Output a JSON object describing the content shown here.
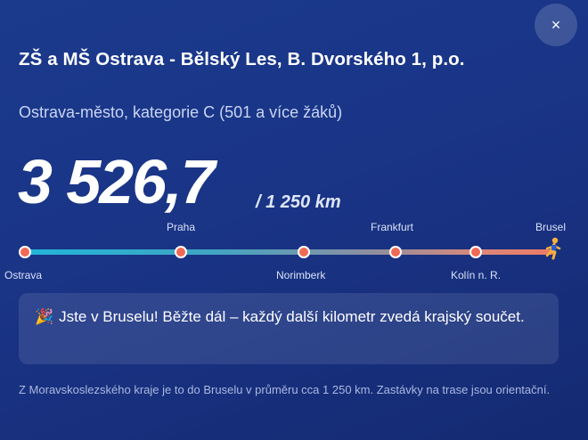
{
  "close_button": {
    "label": "×"
  },
  "school": {
    "name": "ZŠ a MŠ Ostrava - Bělský Les, B. Dvorského 1, p.o.",
    "category": "Ostrava-město, kategorie C (501 a více žáků)"
  },
  "distance": {
    "value": "3 526,7",
    "total": "/ 1 250 km"
  },
  "route": {
    "progress_fraction": 1.0,
    "stops": [
      {
        "name": "Ostrava",
        "label_position": "below"
      },
      {
        "name": "Praha",
        "label_position": "above"
      },
      {
        "name": "Norimberk",
        "label_position": "below"
      },
      {
        "name": "Frankfurt",
        "label_position": "above"
      },
      {
        "name": "Kolín n. R.",
        "label_position": "below"
      },
      {
        "name": "Brusel",
        "label_position": "above"
      }
    ],
    "runner_icon": "runner-icon",
    "accent_color": "#ef6a55"
  },
  "banner": {
    "icon": "party-popper-icon",
    "text": "Jste v Bruselu! Běžte dál – každý další kilometr zvedá krajský součet."
  },
  "footnote": "Z Moravskoslezského kraje je to do Bruselu v průměru cca 1 250 km. Zastávky na trase jsou orientační."
}
